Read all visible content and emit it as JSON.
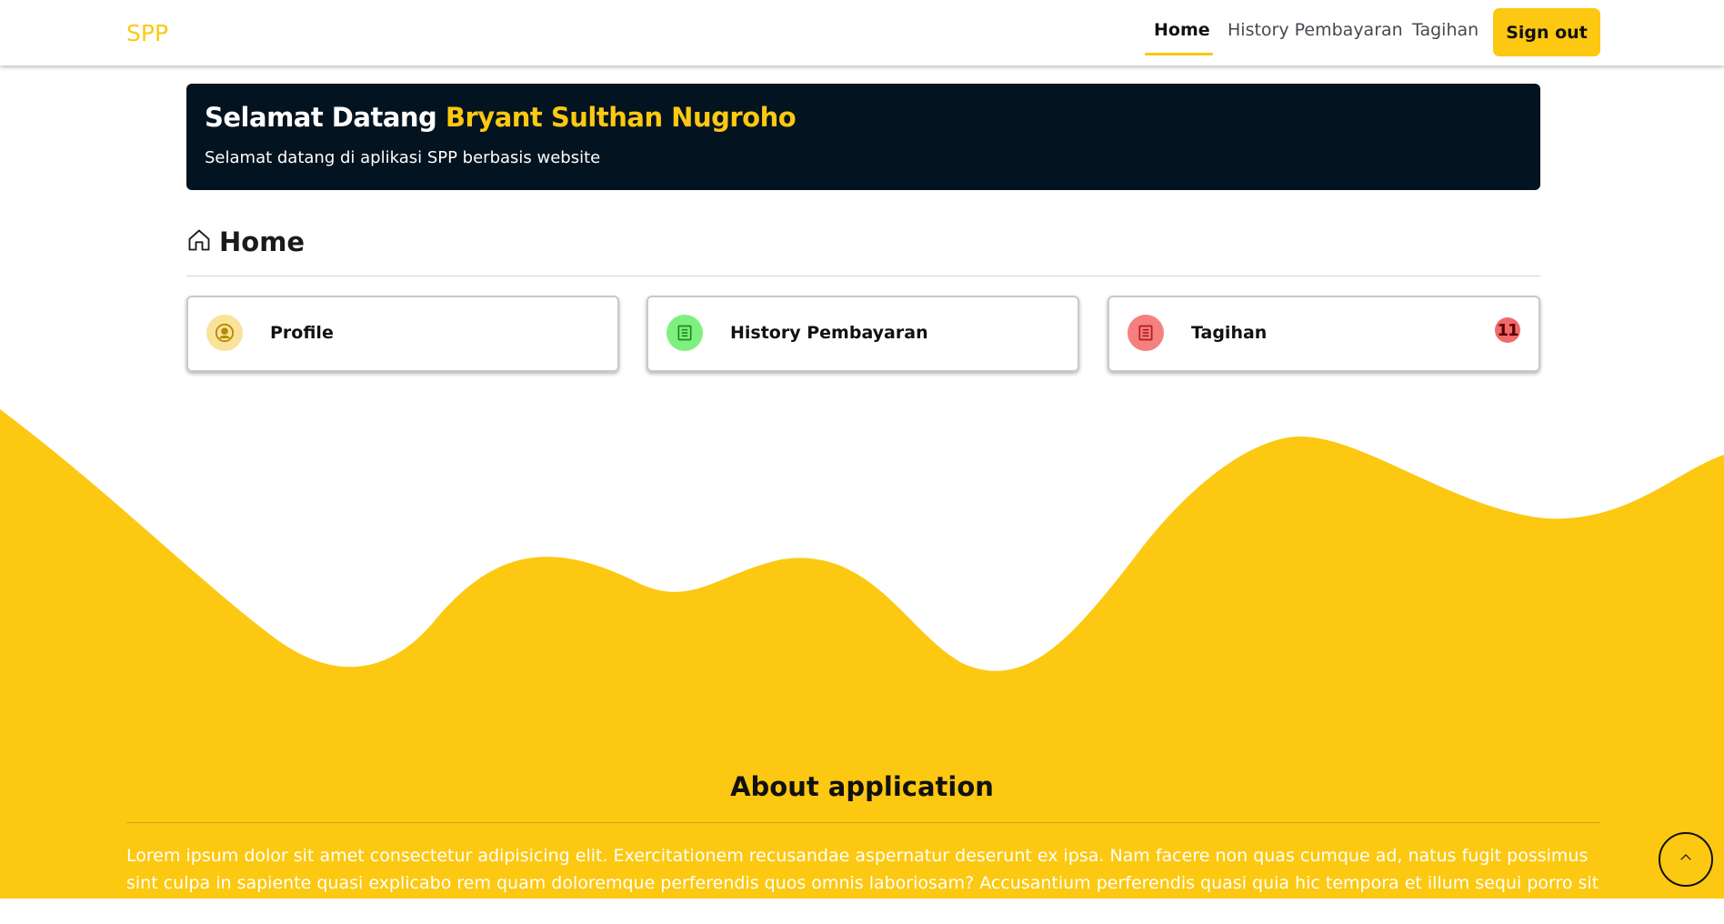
{
  "navbar": {
    "brand": "SPP",
    "links": [
      "Home",
      "History Pembayaran",
      "Tagihan"
    ],
    "active": "Home",
    "signout_label": "Sign out"
  },
  "welcome": {
    "greeting": "Selamat Datang",
    "name": "Bryant Sulthan Nugroho",
    "subtitle": "Selamat datang di aplikasi SPP berbasis website"
  },
  "home": {
    "title": "Home",
    "icon": "house-icon"
  },
  "cards": [
    {
      "label": "Profile",
      "icon": "user-circle-icon",
      "icon_bg": "#fbe29a",
      "icon_color": "#b58a00"
    },
    {
      "label": "History Pembayaran",
      "icon": "document-icon",
      "icon_bg": "#7ff07f",
      "icon_color": "#1e8a1e"
    },
    {
      "label": "Tagihan",
      "icon": "document-icon",
      "icon_bg": "#f58080",
      "icon_color": "#b01c1c",
      "badge": "11"
    }
  ],
  "about": {
    "title": "About application",
    "text": "Lorem ipsum dolor sit amet consectetur adipisicing elit. Exercitationem recusandae aspernatur deserunt ex ipsa. Nam facere non quas cumque ad, natus fugit possimus sint culpa in sapiente quasi explicabo rem quam doloremque perferendis quos omnis laboriosam? Accusantium perferendis quasi quia hic tempora et illum sequi porro sit ut unde"
  },
  "scroll_top_icon": "chevron-up-icon",
  "colors": {
    "accent": "#fcc811",
    "banner": "#03131f",
    "badge": "#f06a6a"
  }
}
